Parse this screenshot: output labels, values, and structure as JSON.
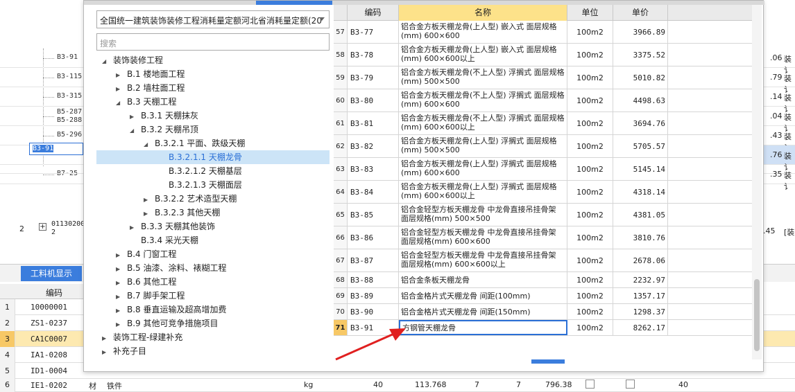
{
  "dialog": {
    "library_select": "全国统一建筑装饰装修工程消耗量定额河北省消耗量定额(20",
    "search_placeholder": "搜索"
  },
  "tree": [
    {
      "label": "装饰装修工程",
      "level": 0,
      "state": "expanded"
    },
    {
      "label": "B.1 楼地面工程",
      "level": 1,
      "state": "collapsed"
    },
    {
      "label": "B.2 墙柱面工程",
      "level": 1,
      "state": "collapsed"
    },
    {
      "label": "B.3 天棚工程",
      "level": 1,
      "state": "expanded"
    },
    {
      "label": "B.3.1 天棚抹灰",
      "level": 2,
      "state": "collapsed"
    },
    {
      "label": "B.3.2 天棚吊顶",
      "level": 2,
      "state": "expanded"
    },
    {
      "label": "B.3.2.1 平面、跌级天棚",
      "level": 3,
      "state": "expanded"
    },
    {
      "label": "B.3.2.1.1 天棚龙骨",
      "level": 4,
      "state": "leaf",
      "selected": true
    },
    {
      "label": "B.3.2.1.2 天棚基层",
      "level": 4,
      "state": "leaf"
    },
    {
      "label": "B.3.2.1.3 天棚面层",
      "level": 4,
      "state": "leaf"
    },
    {
      "label": "B.3.2.2 艺术造型天棚",
      "level": 3,
      "state": "collapsed"
    },
    {
      "label": "B.3.2.3 其他天棚",
      "level": 3,
      "state": "collapsed"
    },
    {
      "label": "B.3.3 天棚其他装饰",
      "level": 2,
      "state": "collapsed"
    },
    {
      "label": "B.3.4 采光天棚",
      "level": 2,
      "state": "leaf"
    },
    {
      "label": "B.4 门窗工程",
      "level": 1,
      "state": "collapsed"
    },
    {
      "label": "B.5 油漆、涂料、裱糊工程",
      "level": 1,
      "state": "collapsed"
    },
    {
      "label": "B.6 其他工程",
      "level": 1,
      "state": "collapsed"
    },
    {
      "label": "B.7 脚手架工程",
      "level": 1,
      "state": "collapsed"
    },
    {
      "label": "B.8 垂直运输及超高增加费",
      "level": 1,
      "state": "collapsed"
    },
    {
      "label": "B.9 其他可竞争措施项目",
      "level": 1,
      "state": "collapsed"
    },
    {
      "label": "装饰工程-绿建补充",
      "level": 0,
      "state": "collapsed"
    },
    {
      "label": "补充子目",
      "level": 0,
      "state": "collapsed"
    }
  ],
  "table": {
    "headers": [
      "编码",
      "名称",
      "单位",
      "单价"
    ],
    "rows": [
      {
        "idx": "57",
        "code": "B3-77",
        "name": "铝合金方板天棚龙骨(上人型) 嵌入式 面层规格(mm) 600×600",
        "unit": "100m2",
        "price": "3966.89"
      },
      {
        "idx": "58",
        "code": "B3-78",
        "name": "铝合金方板天棚龙骨(上人型) 嵌入式 面层规格(mm) 600×600以上",
        "unit": "100m2",
        "price": "3375.52"
      },
      {
        "idx": "59",
        "code": "B3-79",
        "name": "铝合金方板天棚龙骨(不上人型) 浮搁式 面层规格(mm) 500×500",
        "unit": "100m2",
        "price": "5010.82"
      },
      {
        "idx": "60",
        "code": "B3-80",
        "name": "铝合金方板天棚龙骨(不上人型) 浮搁式 面层规格(mm) 600×600",
        "unit": "100m2",
        "price": "4498.63"
      },
      {
        "idx": "61",
        "code": "B3-81",
        "name": "铝合金方板天棚龙骨(不上人型) 浮搁式 面层规格(mm) 600×600以上",
        "unit": "100m2",
        "price": "3694.76"
      },
      {
        "idx": "62",
        "code": "B3-82",
        "name": "铝合金方板天棚龙骨(上人型) 浮搁式 面层规格(mm) 500×500",
        "unit": "100m2",
        "price": "5705.57"
      },
      {
        "idx": "63",
        "code": "B3-83",
        "name": "铝合金方板天棚龙骨(上人型) 浮搁式 面层规格(mm) 600×600",
        "unit": "100m2",
        "price": "5145.14"
      },
      {
        "idx": "64",
        "code": "B3-84",
        "name": "铝合金方板天棚龙骨(上人型) 浮搁式 面层规格(mm) 600×600以上",
        "unit": "100m2",
        "price": "4318.14"
      },
      {
        "idx": "65",
        "code": "B3-85",
        "name": "铝合金轻型方板天棚龙骨 中龙骨直接吊挂骨架 面层规格(mm) 500×500",
        "unit": "100m2",
        "price": "4381.05"
      },
      {
        "idx": "66",
        "code": "B3-86",
        "name": "铝合金轻型方板天棚龙骨 中龙骨直接吊挂骨架 面层规格(mm) 600×600",
        "unit": "100m2",
        "price": "3810.76"
      },
      {
        "idx": "67",
        "code": "B3-87",
        "name": "铝合金轻型方板天棚龙骨 中龙骨直接吊挂骨架 面层规格(mm) 600×600以上",
        "unit": "100m2",
        "price": "2678.06"
      },
      {
        "idx": "68",
        "code": "B3-88",
        "name": "铝合金条板天棚龙骨",
        "unit": "100m2",
        "price": "2232.97"
      },
      {
        "idx": "69",
        "code": "B3-89",
        "name": "铝合金格片式天棚龙骨 间距(100mm)",
        "unit": "100m2",
        "price": "1357.17"
      },
      {
        "idx": "70",
        "code": "B3-90",
        "name": "铝合金格片式天棚龙骨 间距(150mm)",
        "unit": "100m2",
        "price": "1298.37"
      },
      {
        "idx": "71",
        "code": "B3-91",
        "name": "方钢管天棚龙骨",
        "unit": "100m2",
        "price": "8262.17"
      }
    ]
  },
  "background": {
    "tree_codes": [
      "B3-91",
      "B3-115",
      "B3-315",
      "B5-287\nB5-288",
      "B5-296",
      "B3-91",
      "B7-25"
    ],
    "right_values": [
      ".06",
      ".79",
      ".14",
      ".04",
      ".43",
      ".76",
      ".35",
      ".45"
    ],
    "right_text": [
      "装讠",
      "装讠",
      "装讠",
      "装讠",
      "装讠",
      "装讠",
      "装讠",
      "[装"
    ],
    "row2_number": "2",
    "row2_code": "01130200\n2",
    "tab_label": "工料机显示",
    "mat_header_code": "编码",
    "mat_rows": [
      {
        "num": "1",
        "code": "10000001"
      },
      {
        "num": "2",
        "code": "ZS1-0237"
      },
      {
        "num": "3",
        "code": "CA1C0007"
      },
      {
        "num": "4",
        "code": "IA1-0208"
      },
      {
        "num": "5",
        "code": "ID1-0004"
      },
      {
        "num": "6",
        "code": "IE1-0202"
      }
    ],
    "bottom_row": {
      "type": "材",
      "name": "铁件",
      "unit": "kg",
      "qty1": "40",
      "qty2": "113.768",
      "v1": "7",
      "v2": "7",
      "amount": "796.38",
      "last": "40"
    }
  },
  "colors": {
    "accent": "#3b7ddd",
    "header_highlight": "#fde28a",
    "row_highlight": "#f7c866",
    "arrow": "#e02020"
  }
}
